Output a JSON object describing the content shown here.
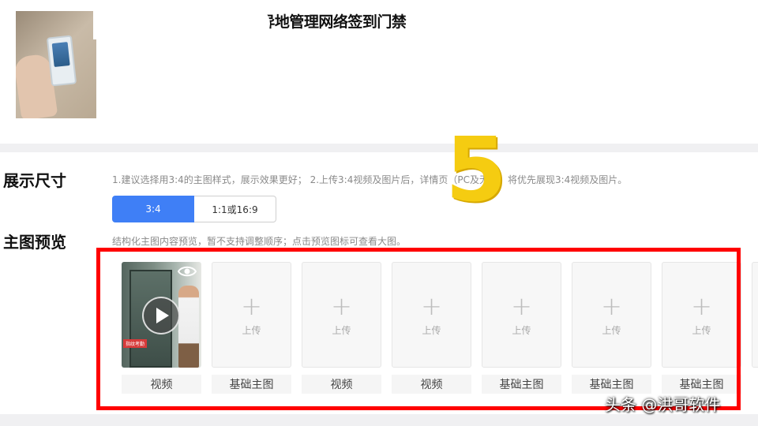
{
  "product": {
    "title": "考勤指纹u盘无线wifi异地管理网络签到门禁"
  },
  "display_size": {
    "label": "展示尺寸",
    "hint": "1.建议选择用3:4的主图样式，展示效果更好； 2.上传3:4视频及图片后，详情页（PC及无线）将优先展现3:4视频及图片。",
    "options": [
      {
        "label": "3:4",
        "active": true
      },
      {
        "label": "1:1或16:9",
        "active": false
      }
    ]
  },
  "overlay_number": "5",
  "preview": {
    "label": "主图预览",
    "hint": "结构化主图内容预览，暂不支持调整顺序；点击预览图标可查看大图。",
    "video_badge": "指纹考勤",
    "upload_text": "上传",
    "items": [
      {
        "type": "video",
        "caption": "视频"
      },
      {
        "type": "upload",
        "caption": "基础主图"
      },
      {
        "type": "upload",
        "caption": "视频"
      },
      {
        "type": "upload",
        "caption": "视频"
      },
      {
        "type": "upload",
        "caption": "基础主图"
      },
      {
        "type": "upload",
        "caption": "基础主图"
      },
      {
        "type": "upload",
        "caption": "基础主图"
      }
    ]
  },
  "watermark": "头条 @洪哥软件",
  "colors": {
    "accent": "#3f7ff6",
    "highlight_frame": "#ff0000",
    "overlay_number": "#f5cc11"
  }
}
